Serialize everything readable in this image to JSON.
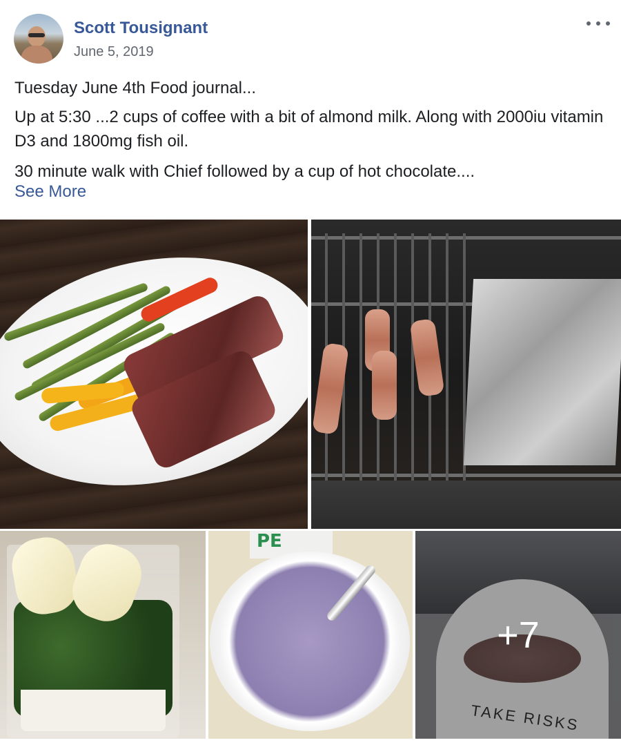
{
  "post": {
    "author": "Scott Tousignant",
    "date": "June 5, 2019",
    "paragraphs": [
      "Tuesday June 4th Food journal...",
      "Up at 5:30 ...2 cups of coffee with a bit of almond milk. Along with 2000iu vitamin D3 and 1800mg fish oil.",
      "30 minute walk with Chief followed by a cup of hot chocolate...."
    ],
    "see_more": "See More"
  },
  "photos": {
    "more_count": "+7",
    "mug_text": "TAKE RISKS",
    "cup_text": "PE"
  },
  "icons": {
    "options": "more-options-icon"
  }
}
